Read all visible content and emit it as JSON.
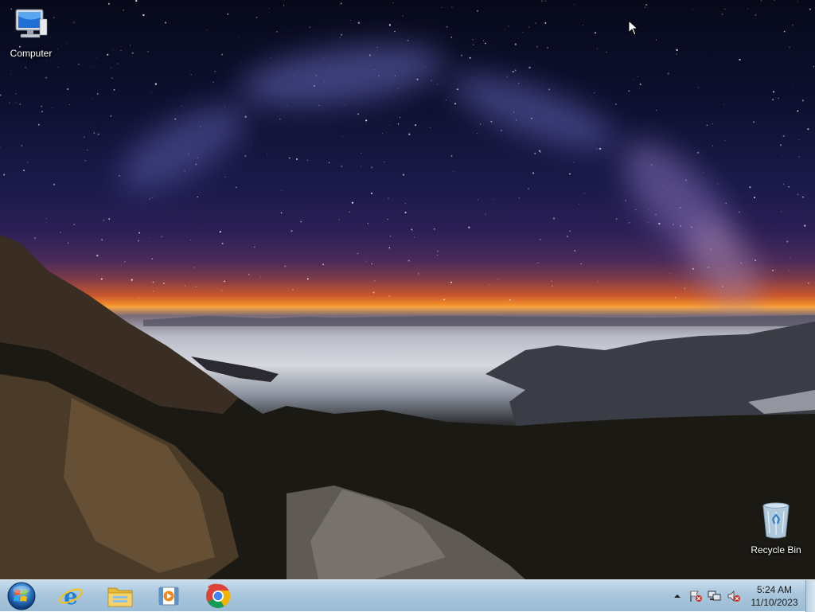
{
  "desktop": {
    "icons": [
      {
        "label": "Computer",
        "icon": "computer-icon"
      },
      {
        "label": "Recycle Bin",
        "icon": "recycle-bin-icon"
      }
    ]
  },
  "taskbar": {
    "start": {
      "icon": "windows-start-icon"
    },
    "pinned": [
      {
        "icon": "internet-explorer-icon"
      },
      {
        "icon": "file-explorer-icon"
      },
      {
        "icon": "media-player-icon"
      },
      {
        "icon": "chrome-icon"
      }
    ],
    "tray": {
      "icons": [
        "show-hidden-icons-arrow",
        "action-center-flag-icon",
        "network-icon",
        "volume-muted-icon"
      ],
      "time": "5:24 AM",
      "date": "11/10/2023"
    }
  }
}
